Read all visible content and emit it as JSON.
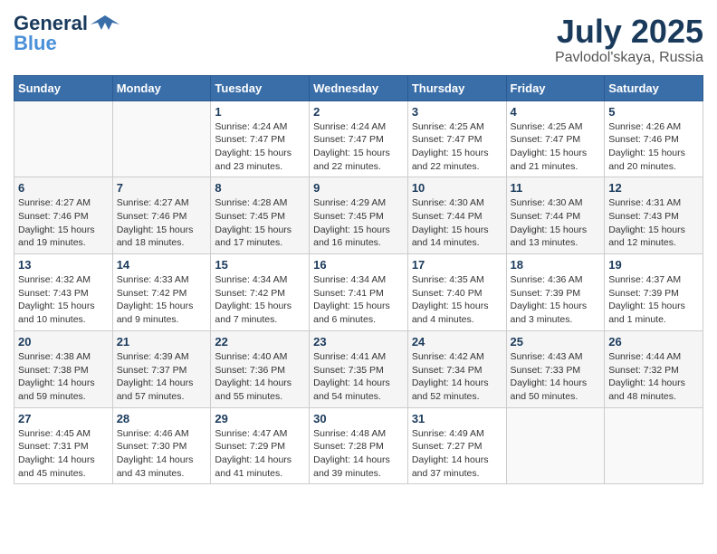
{
  "header": {
    "logo_general": "General",
    "logo_blue": "Blue",
    "month": "July 2025",
    "location": "Pavlodol'skaya, Russia"
  },
  "weekdays": [
    "Sunday",
    "Monday",
    "Tuesday",
    "Wednesday",
    "Thursday",
    "Friday",
    "Saturday"
  ],
  "weeks": [
    [
      {
        "day": "",
        "info": ""
      },
      {
        "day": "",
        "info": ""
      },
      {
        "day": "1",
        "info": "Sunrise: 4:24 AM\nSunset: 7:47 PM\nDaylight: 15 hours and 23 minutes."
      },
      {
        "day": "2",
        "info": "Sunrise: 4:24 AM\nSunset: 7:47 PM\nDaylight: 15 hours and 22 minutes."
      },
      {
        "day": "3",
        "info": "Sunrise: 4:25 AM\nSunset: 7:47 PM\nDaylight: 15 hours and 22 minutes."
      },
      {
        "day": "4",
        "info": "Sunrise: 4:25 AM\nSunset: 7:47 PM\nDaylight: 15 hours and 21 minutes."
      },
      {
        "day": "5",
        "info": "Sunrise: 4:26 AM\nSunset: 7:46 PM\nDaylight: 15 hours and 20 minutes."
      }
    ],
    [
      {
        "day": "6",
        "info": "Sunrise: 4:27 AM\nSunset: 7:46 PM\nDaylight: 15 hours and 19 minutes."
      },
      {
        "day": "7",
        "info": "Sunrise: 4:27 AM\nSunset: 7:46 PM\nDaylight: 15 hours and 18 minutes."
      },
      {
        "day": "8",
        "info": "Sunrise: 4:28 AM\nSunset: 7:45 PM\nDaylight: 15 hours and 17 minutes."
      },
      {
        "day": "9",
        "info": "Sunrise: 4:29 AM\nSunset: 7:45 PM\nDaylight: 15 hours and 16 minutes."
      },
      {
        "day": "10",
        "info": "Sunrise: 4:30 AM\nSunset: 7:44 PM\nDaylight: 15 hours and 14 minutes."
      },
      {
        "day": "11",
        "info": "Sunrise: 4:30 AM\nSunset: 7:44 PM\nDaylight: 15 hours and 13 minutes."
      },
      {
        "day": "12",
        "info": "Sunrise: 4:31 AM\nSunset: 7:43 PM\nDaylight: 15 hours and 12 minutes."
      }
    ],
    [
      {
        "day": "13",
        "info": "Sunrise: 4:32 AM\nSunset: 7:43 PM\nDaylight: 15 hours and 10 minutes."
      },
      {
        "day": "14",
        "info": "Sunrise: 4:33 AM\nSunset: 7:42 PM\nDaylight: 15 hours and 9 minutes."
      },
      {
        "day": "15",
        "info": "Sunrise: 4:34 AM\nSunset: 7:42 PM\nDaylight: 15 hours and 7 minutes."
      },
      {
        "day": "16",
        "info": "Sunrise: 4:34 AM\nSunset: 7:41 PM\nDaylight: 15 hours and 6 minutes."
      },
      {
        "day": "17",
        "info": "Sunrise: 4:35 AM\nSunset: 7:40 PM\nDaylight: 15 hours and 4 minutes."
      },
      {
        "day": "18",
        "info": "Sunrise: 4:36 AM\nSunset: 7:39 PM\nDaylight: 15 hours and 3 minutes."
      },
      {
        "day": "19",
        "info": "Sunrise: 4:37 AM\nSunset: 7:39 PM\nDaylight: 15 hours and 1 minute."
      }
    ],
    [
      {
        "day": "20",
        "info": "Sunrise: 4:38 AM\nSunset: 7:38 PM\nDaylight: 14 hours and 59 minutes."
      },
      {
        "day": "21",
        "info": "Sunrise: 4:39 AM\nSunset: 7:37 PM\nDaylight: 14 hours and 57 minutes."
      },
      {
        "day": "22",
        "info": "Sunrise: 4:40 AM\nSunset: 7:36 PM\nDaylight: 14 hours and 55 minutes."
      },
      {
        "day": "23",
        "info": "Sunrise: 4:41 AM\nSunset: 7:35 PM\nDaylight: 14 hours and 54 minutes."
      },
      {
        "day": "24",
        "info": "Sunrise: 4:42 AM\nSunset: 7:34 PM\nDaylight: 14 hours and 52 minutes."
      },
      {
        "day": "25",
        "info": "Sunrise: 4:43 AM\nSunset: 7:33 PM\nDaylight: 14 hours and 50 minutes."
      },
      {
        "day": "26",
        "info": "Sunrise: 4:44 AM\nSunset: 7:32 PM\nDaylight: 14 hours and 48 minutes."
      }
    ],
    [
      {
        "day": "27",
        "info": "Sunrise: 4:45 AM\nSunset: 7:31 PM\nDaylight: 14 hours and 45 minutes."
      },
      {
        "day": "28",
        "info": "Sunrise: 4:46 AM\nSunset: 7:30 PM\nDaylight: 14 hours and 43 minutes."
      },
      {
        "day": "29",
        "info": "Sunrise: 4:47 AM\nSunset: 7:29 PM\nDaylight: 14 hours and 41 minutes."
      },
      {
        "day": "30",
        "info": "Sunrise: 4:48 AM\nSunset: 7:28 PM\nDaylight: 14 hours and 39 minutes."
      },
      {
        "day": "31",
        "info": "Sunrise: 4:49 AM\nSunset: 7:27 PM\nDaylight: 14 hours and 37 minutes."
      },
      {
        "day": "",
        "info": ""
      },
      {
        "day": "",
        "info": ""
      }
    ]
  ]
}
